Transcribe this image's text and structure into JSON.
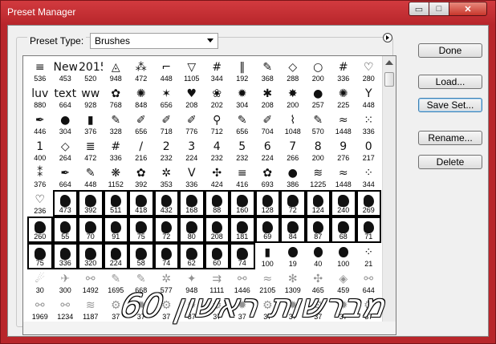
{
  "window": {
    "title": "Preset Manager",
    "controls": {
      "minimize": "▭",
      "maximize": "□",
      "close": "✕"
    }
  },
  "preset_type": {
    "label": "Preset Type:",
    "value": "Brushes"
  },
  "buttons": {
    "done": "Done",
    "load": "Load...",
    "save_set": "Save Set...",
    "rename": "Rename...",
    "delete": "Delete"
  },
  "watermark": "מברשות ראשון 60",
  "brush_rows": [
    {
      "selected": false,
      "glyph": "hand",
      "sizes": [
        "536",
        "453",
        "520",
        "948",
        "472",
        "448",
        "1105",
        "344",
        "192",
        "368",
        "288",
        "200",
        "336",
        "280"
      ]
    },
    {
      "selected": false,
      "glyph": "hand",
      "sizes": [
        "880",
        "664",
        "928",
        "768",
        "848",
        "656",
        "208",
        "202",
        "304",
        "208",
        "200",
        "257",
        "225",
        "448"
      ]
    },
    {
      "selected": false,
      "glyph": "hand",
      "sizes": [
        "446",
        "304",
        "376",
        "328",
        "656",
        "718",
        "776",
        "712",
        "656",
        "704",
        "1048",
        "570",
        "1448",
        "336"
      ]
    },
    {
      "selected": false,
      "glyph": "digit",
      "sizes": [
        "400",
        "264",
        "472",
        "336",
        "216",
        "232",
        "224",
        "232",
        "232",
        "224",
        "266",
        "200",
        "276",
        "217"
      ]
    },
    {
      "selected": false,
      "glyph": "hand",
      "sizes": [
        "376",
        "664",
        "448",
        "1152",
        "392",
        "353",
        "336",
        "424",
        "416",
        "693",
        "386",
        "1225",
        "1448",
        "344"
      ]
    },
    {
      "selected": true,
      "glyph": "solid",
      "sizes": [
        "236",
        "473",
        "392",
        "511",
        "418",
        "432",
        "168",
        "88",
        "160",
        "128",
        "72",
        "124",
        "240",
        "269"
      ]
    },
    {
      "selected": true,
      "glyph": "solid",
      "sizes": [
        "260",
        "55",
        "70",
        "91",
        "75",
        "72",
        "80",
        "208",
        "181",
        "69",
        "84",
        "87",
        "68",
        "71"
      ]
    },
    {
      "selected": true,
      "glyph": "solid",
      "sizes": [
        "75",
        "336",
        "320",
        "224",
        "58",
        "74",
        "62",
        "60",
        "74",
        "100",
        "19",
        "40",
        "100",
        "21"
      ]
    },
    {
      "selected": false,
      "glyph": "faded",
      "sizes": [
        "30",
        "300",
        "1492",
        "1695",
        "668",
        "577",
        "948",
        "1111",
        "1446",
        "2105",
        "1309",
        "465",
        "459",
        "644"
      ]
    },
    {
      "selected": false,
      "glyph": "faded",
      "sizes": [
        "1969",
        "1234",
        "1187",
        "37",
        "37",
        "37",
        "37",
        "37",
        "37",
        "37",
        "37",
        "37",
        "37",
        "37"
      ]
    }
  ],
  "glyph_sets": {
    "row0": [
      "≡",
      "New",
      "2015",
      "◬",
      "⁂",
      "⌐",
      "▽",
      "#",
      "‖",
      "✎",
      "◇",
      "○",
      "#",
      "♡"
    ],
    "row1": [
      "luv",
      "text",
      "ww",
      "✿",
      "✺",
      "✶",
      "♥",
      "❀",
      "✹",
      "✱",
      "✸",
      "●",
      "✺",
      "Y"
    ],
    "row2": [
      "✒",
      "●",
      "▮",
      "✎",
      "✐",
      "✐",
      "✐",
      "⚲",
      "✎",
      "✐",
      "⌇",
      "✎",
      "≈",
      "⁙"
    ],
    "row3": [
      "1",
      "◇",
      "≣",
      "#",
      "/",
      "2",
      "3",
      "4",
      "5",
      "6",
      "7",
      "8",
      "9",
      "0"
    ],
    "row4": [
      "⁑",
      "✒",
      "✎",
      "❋",
      "✿",
      "✲",
      "V",
      "✣",
      "≡",
      "✿",
      "●",
      "≋",
      "≈",
      "⁘"
    ],
    "row5": [
      "♡"
    ],
    "row7_tail": [
      "▮",
      "●",
      "●",
      "●",
      "⁘"
    ],
    "row8": [
      "☄",
      "✈",
      "⚯",
      "✎",
      "✎",
      "✲",
      "✦",
      "⇉",
      "⚯",
      "≈",
      "✻",
      "✣",
      "◈",
      "⚯"
    ],
    "row9": [
      "⚯",
      "⚯",
      "≋",
      "⚙",
      "✹",
      "⚙",
      "✹",
      "⚙",
      "✹",
      "⚙",
      "✹",
      "⚙",
      "✹",
      "⚙"
    ]
  }
}
